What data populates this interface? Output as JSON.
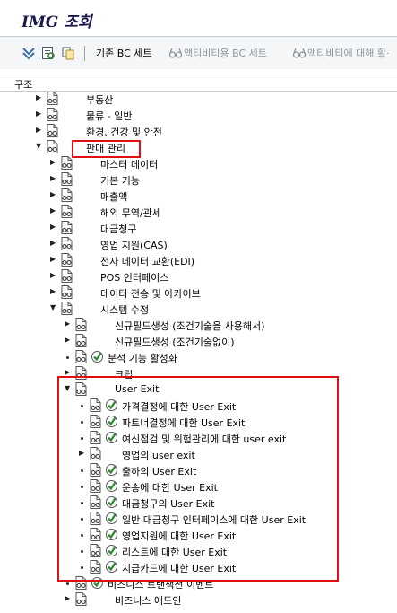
{
  "window": {
    "title": "IMG 조회"
  },
  "toolbar": {
    "std_bc_set": "기존 BC 세트",
    "activity_bc_set": "액티비티용 BC 세트",
    "activity_bc_set_check": "액티비티에 대해 활·"
  },
  "tree_header": "구조",
  "tree": [
    {
      "label": "부동산",
      "level": 1,
      "node": "closed",
      "exec": false
    },
    {
      "label": "물류 - 일반",
      "level": 1,
      "node": "closed",
      "exec": false
    },
    {
      "label": "환경, 건강 및 안전",
      "level": 1,
      "node": "closed",
      "exec": false
    },
    {
      "label": "판매 관리",
      "level": 1,
      "node": "open",
      "exec": false
    },
    {
      "label": "마스터 데이터",
      "level": 2,
      "node": "closed",
      "exec": false
    },
    {
      "label": "기본 기능",
      "level": 2,
      "node": "closed",
      "exec": false
    },
    {
      "label": "매출액",
      "level": 2,
      "node": "closed",
      "exec": false
    },
    {
      "label": "해외 무역/관세",
      "level": 2,
      "node": "closed",
      "exec": false
    },
    {
      "label": "대금청구",
      "level": 2,
      "node": "closed",
      "exec": false
    },
    {
      "label": "영업 지원(CAS)",
      "level": 2,
      "node": "closed",
      "exec": false
    },
    {
      "label": "전자 데이터 교환(EDI)",
      "level": 2,
      "node": "closed",
      "exec": false
    },
    {
      "label": "POS 인터페이스",
      "level": 2,
      "node": "closed",
      "exec": false
    },
    {
      "label": "데이터 전송 및 아카이브",
      "level": 2,
      "node": "closed",
      "exec": false
    },
    {
      "label": "시스템 수정",
      "level": 2,
      "node": "open",
      "exec": false
    },
    {
      "label": "신규필드생성 (조건기술을 사용해서)",
      "level": 3,
      "node": "closed",
      "exec": false
    },
    {
      "label": "신규필드생성 (조건기술없이)",
      "level": 3,
      "node": "closed",
      "exec": false
    },
    {
      "label": "분석 기능 활성화",
      "level": 3,
      "node": "leaf",
      "exec": true
    },
    {
      "label": "크립",
      "level": 3,
      "node": "closed",
      "exec": false
    },
    {
      "label": "User Exit",
      "level": 3,
      "node": "open",
      "exec": false
    },
    {
      "label": "가격결정에 대한 User Exit",
      "level": 4,
      "node": "leaf",
      "exec": true
    },
    {
      "label": "파트너결정에 대한 User Exit",
      "level": 4,
      "node": "leaf",
      "exec": true
    },
    {
      "label": "여신점검 및 위험관리에 대한 user exit",
      "level": 4,
      "node": "leaf",
      "exec": true
    },
    {
      "label": "영업의 user exit",
      "level": 4,
      "node": "closed",
      "exec": false
    },
    {
      "label": "출하의 User Exit",
      "level": 4,
      "node": "leaf",
      "exec": true
    },
    {
      "label": "운송에 대한 User Exit",
      "level": 4,
      "node": "leaf",
      "exec": true
    },
    {
      "label": "대금청구의 User Exit",
      "level": 4,
      "node": "leaf",
      "exec": true
    },
    {
      "label": "일반 대금청구 인터페이스에 대한 User Exit",
      "level": 4,
      "node": "leaf",
      "exec": true
    },
    {
      "label": "영업지원에 대한 User Exit",
      "level": 4,
      "node": "leaf",
      "exec": true
    },
    {
      "label": "리스트에 대한 User Exit",
      "level": 4,
      "node": "leaf",
      "exec": true
    },
    {
      "label": "지급카드에 대한 User Exit",
      "level": 4,
      "node": "leaf",
      "exec": true
    },
    {
      "label": "비즈니스 트랜잭션 이벤트",
      "level": 3,
      "node": "leaf",
      "exec": true
    },
    {
      "label": "비즈니스 애드인",
      "level": 3,
      "node": "closed",
      "exec": false
    }
  ],
  "colors": {
    "highlight_border": "#e01010",
    "exec_green": "#2a8a2a"
  }
}
